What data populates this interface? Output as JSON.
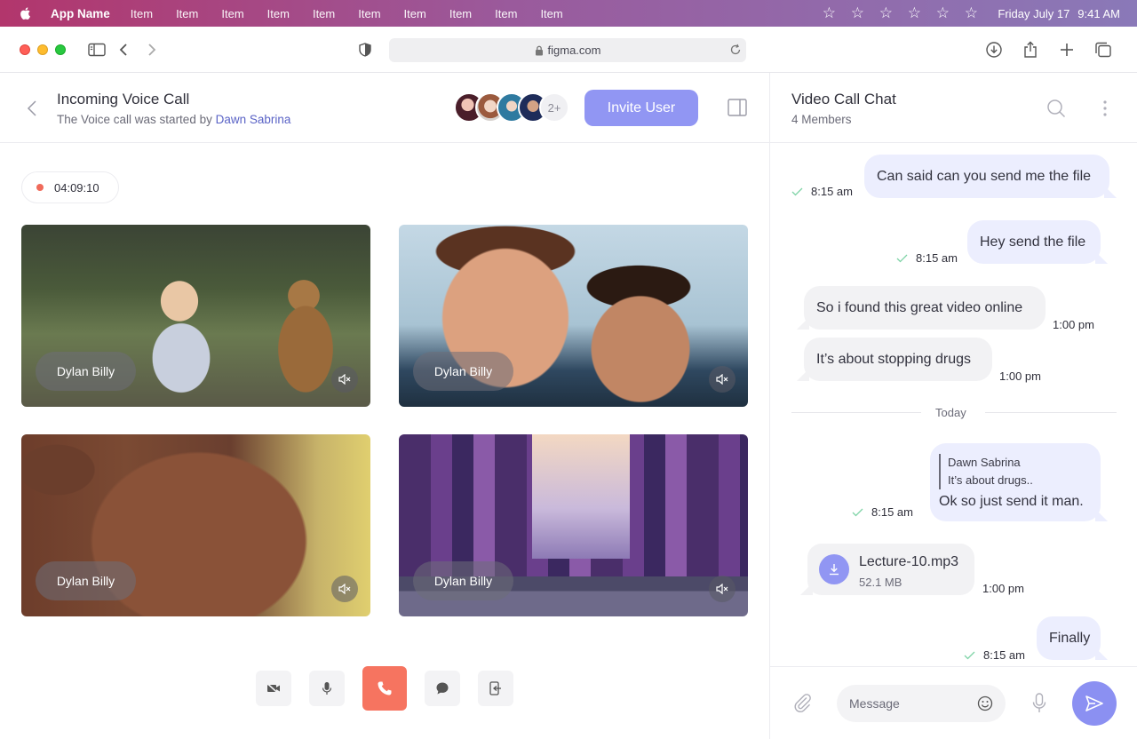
{
  "menubar": {
    "app_name": "App Name",
    "items": [
      "Item",
      "Item",
      "Item",
      "Item",
      "Item",
      "Item",
      "Item",
      "Item",
      "Item",
      "Item"
    ],
    "stars": [
      "☆",
      "☆",
      "☆",
      "☆",
      "☆",
      "☆"
    ],
    "date": "Friday July 17",
    "time": "9:41 AM"
  },
  "browser": {
    "url": "figma.com"
  },
  "call": {
    "title": "Incoming Voice Call",
    "subtitle_prefix": "The Voice call was started by",
    "starter": "Dawn Sabrina",
    "extra_participants": "2+",
    "invite_label": "Invite User",
    "timer": "04:09:10",
    "tiles": [
      {
        "name": "Dylan Billy"
      },
      {
        "name": "Dylan Billy"
      },
      {
        "name": "Dylan Billy"
      },
      {
        "name": "Dylan Billy"
      }
    ]
  },
  "chat": {
    "title": "Video Call Chat",
    "members": "4 Members",
    "messages": [
      {
        "text": "Can said can you send me the file",
        "time": "8:15 am"
      },
      {
        "text": "Hey send the file",
        "time": "8:15 am"
      },
      {
        "text": "So i found this great video online",
        "time": "1:00 pm"
      },
      {
        "text": "It’s about stopping drugs",
        "time": "1:00 pm"
      }
    ],
    "divider": "Today",
    "reply": {
      "quoted_author": "Dawn Sabrina",
      "quoted_text": "It’s about drugs..",
      "text": "Ok so just send it man.",
      "time": "8:15 am"
    },
    "file": {
      "name": "Lecture-10.mp3",
      "size": "52.1 MB",
      "time": "1:00 pm"
    },
    "last": {
      "text": "Finally",
      "time": "8:15 am"
    },
    "composer_placeholder": "Message"
  },
  "colors": {
    "accent": "#9196f3",
    "end_call": "#f67460",
    "outgoing_bubble": "#eceefe",
    "incoming_bubble": "#f2f2f4",
    "starter_link": "#5a63c6"
  }
}
